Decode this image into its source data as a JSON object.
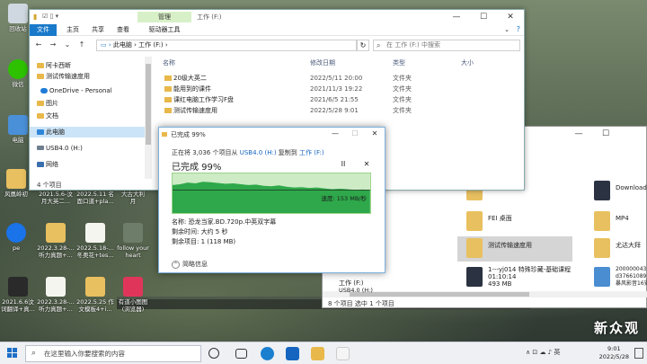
{
  "desktop": {
    "icons": [
      {
        "label": "回收站"
      },
      {
        "label": "微信"
      },
      {
        "label": "电脑"
      },
      {
        "label": "风凰岭初"
      },
      {
        "label": "2021.5.6-汶\n月大英二..."
      },
      {
        "label": "2022.5.11 名\n面口道+pla..."
      },
      {
        "label": "大古大利\n月"
      },
      {
        "label": "2022.3.28-...\n听力真题+..."
      },
      {
        "label": "2022.5.18-...\n冬奥花+tes..."
      },
      {
        "label": "follow your\nheart"
      },
      {
        "label": "2021.6.6汶\n词翻译+真..."
      },
      {
        "label": "2022.3.28-...\n听力真题+..."
      },
      {
        "label": "2022.5.25 作\n文模板4+i..."
      },
      {
        "label": "有道小图图\n(浏览器)"
      },
      {
        "label": "pe"
      }
    ],
    "brand": "新众观"
  },
  "explorer_main": {
    "manage_tab": "管理",
    "title": "工作 (F:)",
    "ribbon_tabs": [
      "文件",
      "主页",
      "共享",
      "查看",
      "驱动器工具"
    ],
    "address": "此电脑 › 工作 (F:) ›",
    "search_placeholder": "在 工作 (F:) 中搜索",
    "sidebar": [
      {
        "label": "阿卡西断"
      },
      {
        "label": "测试传输速度用"
      },
      {
        "label": "OneDrive - Personal"
      },
      {
        "label": "图片"
      },
      {
        "label": "文档"
      },
      {
        "label": "此电脑"
      },
      {
        "label": "USB4.0 (H:)"
      },
      {
        "label": "网络"
      }
    ],
    "columns": {
      "name": "名称",
      "date": "修改日期",
      "type": "类型",
      "size": "大小"
    },
    "files": [
      {
        "name": "20级大英二",
        "date": "2022/5/11 20:00",
        "type": "文件夹"
      },
      {
        "name": "能用到的课件",
        "date": "2021/11/3 19:22",
        "type": "文件夹"
      },
      {
        "name": "课红电脑工作学习F盘",
        "date": "2021/6/5 21:55",
        "type": "文件夹"
      },
      {
        "name": "测试传输速度用",
        "date": "2022/5/28 9:01",
        "type": "文件夹"
      }
    ],
    "status": "4 个项目"
  },
  "copy_dialog": {
    "title": "已完成 99%",
    "info_prefix": "正在将 3,036 个项目从",
    "info_source": "USB4.0 (H:)",
    "info_mid": "复制到",
    "info_dest": "工作 (F:)",
    "percent_label": "已完成 99%",
    "progress_percent": 99,
    "speed": "速度: 153 MB/秒",
    "name_line": "名称: 恐龙当家.BD.720p.中英双字幕",
    "remaining_time": "剩余时间: 大约 5 秒",
    "remaining_items": "剩余项目: 1 (118 MB)",
    "less_info": "简略信息",
    "pause_glyph": "II",
    "close_glyph": "✕",
    "throughput_profile": [
      0.72,
      0.74,
      0.78,
      0.76,
      0.8,
      0.79,
      0.77,
      0.75,
      0.76,
      0.74,
      0.72,
      0.73,
      0.7,
      0.69,
      0.71,
      0.68,
      0.66,
      0.67,
      0.65,
      0.66,
      0.64,
      0.62,
      0.63,
      0.62,
      0.6,
      0.61,
      0.6
    ]
  },
  "explorer_second": {
    "items": [
      {
        "label": "Download"
      },
      {
        "label": "FEI 桌面"
      },
      {
        "label": "MP4"
      },
      {
        "label": "测试传输速度用"
      },
      {
        "label": "尤达大拜"
      },
      {
        "label": "1---yj014 特殊珍藏-基础课程\n01:10:14\n493 MB"
      },
      {
        "label": "2000000435_\nd37661089_\n暴风影音16安"
      }
    ],
    "nav_work": "工作 (F:)",
    "nav_usb": "USB4.0 (H:)",
    "status": "8 个项目    选中 1 个项目"
  },
  "taskbar": {
    "search_placeholder": "在这里输入你要搜索的内容",
    "tray": "∧  ⊡  ☁  ♪  英",
    "time": "9:01",
    "date": "2022/5/28"
  },
  "colors": {
    "accent": "#1979ca",
    "graph_fill": "#2ea84a",
    "graph_border": "#9bd48a"
  }
}
